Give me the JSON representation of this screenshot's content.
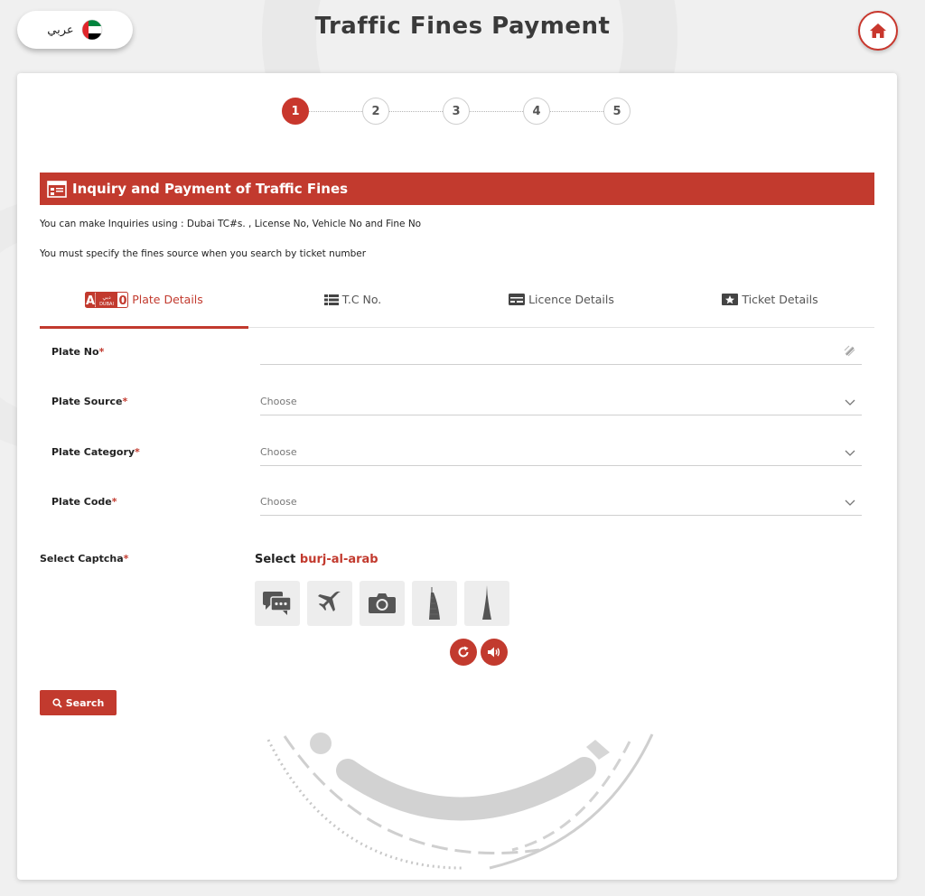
{
  "header": {
    "title": "Traffic Fines Payment",
    "language_label": "عربي"
  },
  "stepper": {
    "steps": [
      "1",
      "2",
      "3",
      "4",
      "5"
    ],
    "active": 1
  },
  "section": {
    "title": "Inquiry and Payment of Traffic Fines",
    "info1": "You can make Inquiries using : Dubai TC#s. , License No, Vehicle No and Fine No",
    "info2": "You must specify the fines source when you search by ticket number"
  },
  "tabs": [
    {
      "label": "Plate Details"
    },
    {
      "label": "T.C No."
    },
    {
      "label": "Licence Details"
    },
    {
      "label": "Ticket Details"
    }
  ],
  "plate_badge": {
    "letter": "A",
    "emirate_ar": "دبي",
    "emirate_en": "DUBAI",
    "number": "0"
  },
  "form": {
    "plate_no": {
      "label": "Plate No",
      "value": ""
    },
    "plate_source": {
      "label": "Plate Source",
      "value": "Choose"
    },
    "plate_category": {
      "label": "Plate Category",
      "value": "Choose"
    },
    "plate_code": {
      "label": "Plate Code",
      "value": "Choose"
    },
    "required_mark": "*"
  },
  "captcha": {
    "label": "Select Captcha",
    "prompt": "Select",
    "target": "burj-al-arab",
    "icons": [
      "chat-icon",
      "airplane-icon",
      "camera-icon",
      "burj-al-arab-icon",
      "burj-khalifa-icon"
    ]
  },
  "search": {
    "label": "Search"
  },
  "colors": {
    "accent": "#c23a2e",
    "background": "#f0f0f0"
  }
}
